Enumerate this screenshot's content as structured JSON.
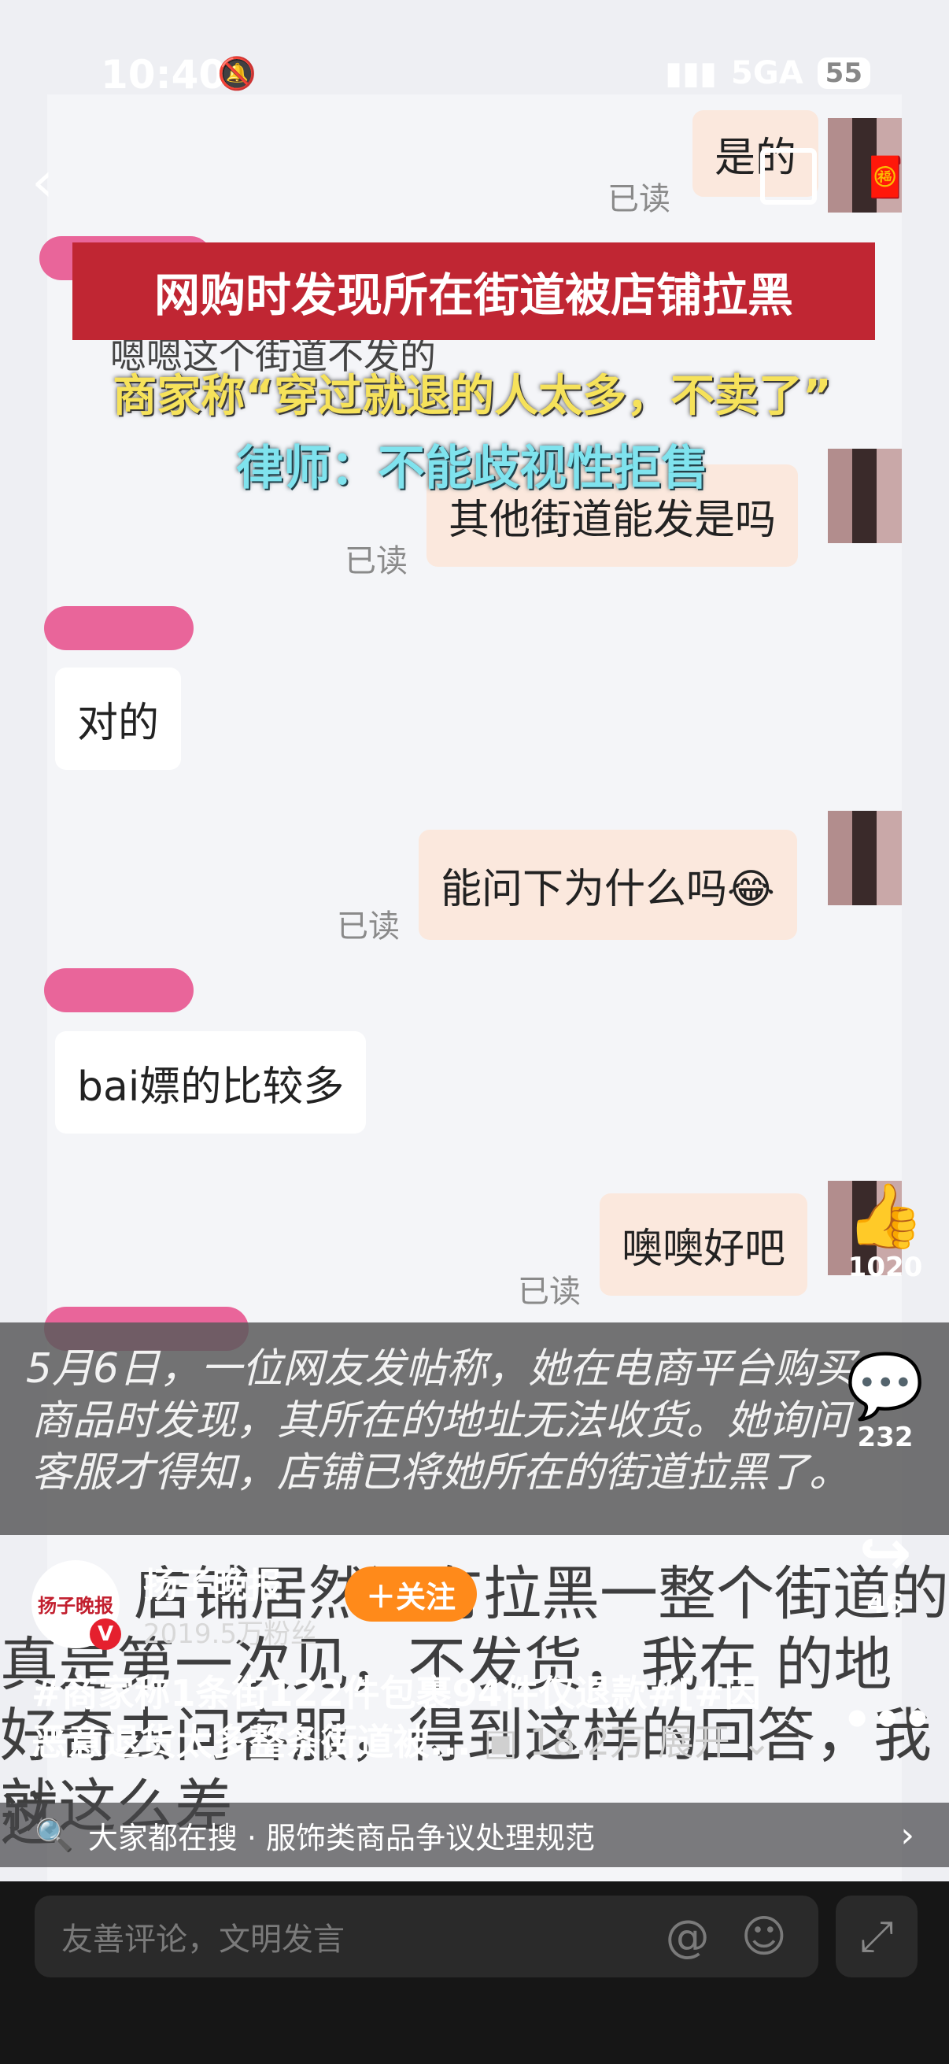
{
  "status_bar": {
    "time": "10:40",
    "network": "5GA",
    "battery": "55"
  },
  "chat": {
    "msg_shi_de": "是的",
    "read_label": "已读",
    "obscured_line": "嗯嗯这个街道不发的",
    "msg_other_street": "其他街道能发是吗",
    "msg_dui_de": "对的",
    "msg_why": "能问下为什么吗😂",
    "msg_bai_piao": "bai嫖的比较多",
    "msg_ok": "噢噢好吧"
  },
  "overlay": {
    "headline": "网购时发现所在街道被店铺拉黑",
    "quote": "商家称“穿过就退的人太多，不卖了”",
    "lawyer": "律师：不能歧视性拒售",
    "caption": "5月6日，一位网友发帖称，她在电商平台购买商品时发现，其所在的地址无法收货。她询问客服才得知，店铺已将她所在的街道拉黑了。",
    "bg_line1": "店铺居然还有拉黑一整个街道的",
    "bg_line2": "真是第一次见，不发货，我在 的地",
    "bg_line3": "好奇去问客服，得到这样的回答，我这",
    "bg_line4": "就这么差"
  },
  "actions": {
    "likes": "1020",
    "comments": "232",
    "shares": "46"
  },
  "publisher": {
    "name": "扬子晚报",
    "fans": "2019.5万粉丝",
    "follow": "关注",
    "avatar_text": "扬子晚报"
  },
  "description": {
    "text": "#商家称1条街122件包裹94件仅退款#[#因恶意退货太多整条街道被...",
    "views": "18.2万",
    "expand": "展开"
  },
  "search": {
    "text": "大家都在搜 · 服饰类商品争议处理规范"
  },
  "comment": {
    "placeholder": "友善评论，文明发言"
  }
}
